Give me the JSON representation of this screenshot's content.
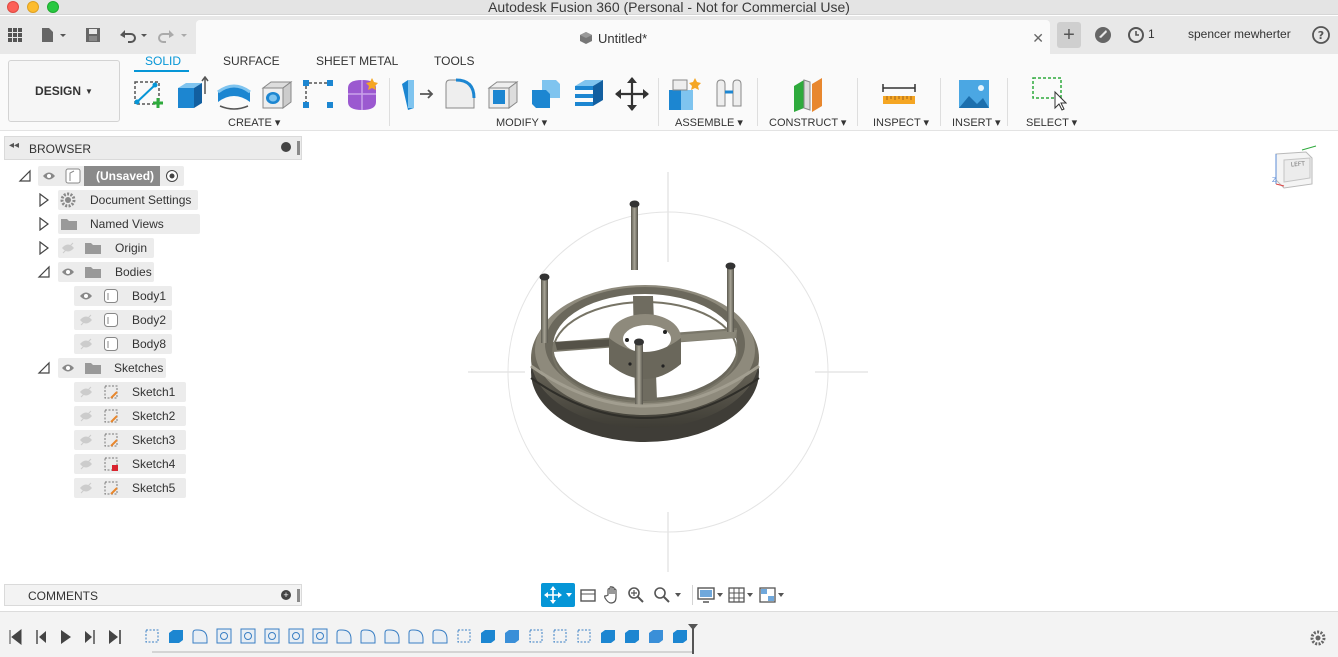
{
  "window": {
    "title": "Autodesk Fusion 360 (Personal - Not for Commercial Use)"
  },
  "appbar": {
    "document_tab": "Untitled*",
    "job_count": "1",
    "user_name": "spencer mewherter",
    "icons": [
      "apps-grid-icon",
      "file-menu-icon",
      "save-icon",
      "undo-icon",
      "redo-icon",
      "new-tab-icon",
      "extensions-icon",
      "job-status-icon",
      "help-icon"
    ]
  },
  "toolbar": {
    "workspace": "DESIGN",
    "tabs": [
      {
        "label": "SOLID",
        "active": true
      },
      {
        "label": "SURFACE",
        "active": false
      },
      {
        "label": "SHEET METAL",
        "active": false
      },
      {
        "label": "TOOLS",
        "active": false
      }
    ],
    "groups": {
      "create": "CREATE",
      "modify": "MODIFY",
      "assemble": "ASSEMBLE",
      "construct": "CONSTRUCT",
      "inspect": "INSPECT",
      "insert": "INSERT",
      "select": "SELECT"
    },
    "accent_color": "#0696d7"
  },
  "browser": {
    "title": "BROWSER",
    "root": "(Unsaved)",
    "items": [
      {
        "label": "Document Settings"
      },
      {
        "label": "Named Views"
      },
      {
        "label": "Origin"
      },
      {
        "label": "Bodies"
      },
      {
        "label": "Body1"
      },
      {
        "label": "Body2"
      },
      {
        "label": "Body8"
      },
      {
        "label": "Sketches"
      },
      {
        "label": "Sketch1"
      },
      {
        "label": "Sketch2"
      },
      {
        "label": "Sketch3"
      },
      {
        "label": "Sketch4"
      },
      {
        "label": "Sketch5"
      }
    ]
  },
  "comments": {
    "title": "COMMENTS"
  },
  "viewcube": {
    "face": "LEFT"
  },
  "timeline": {
    "feature_count": 23
  }
}
